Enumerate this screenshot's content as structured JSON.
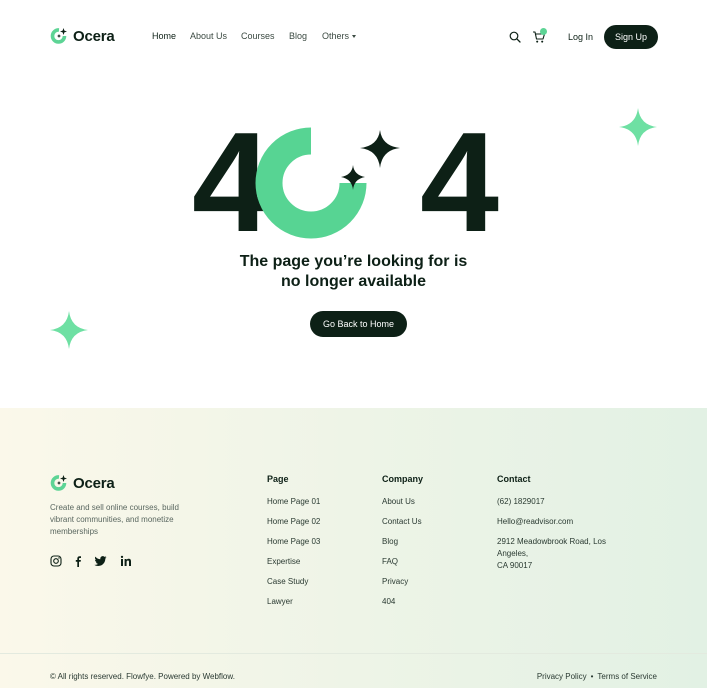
{
  "brand": {
    "name": "Ocera",
    "accent": "#5dd495",
    "dark": "#0d2016"
  },
  "nav": {
    "items": [
      "Home",
      "About Us",
      "Courses",
      "Blog",
      "Others"
    ],
    "login": "Log In",
    "signup": "Sign Up"
  },
  "hero": {
    "code_digit_left": "4",
    "code_digit_right": "4",
    "headline_line1": "The page you’re looking for is",
    "headline_line2": "no longer available",
    "cta": "Go Back to Home"
  },
  "footer": {
    "brand_name": "Ocera",
    "description": "Create and sell online courses, build vibrant communities, and monetize memberships",
    "socials": [
      "instagram-icon",
      "facebook-icon",
      "twitter-icon",
      "linkedin-icon"
    ],
    "columns": [
      {
        "title": "Page",
        "links": [
          "Home Page 01",
          "Home Page 02",
          "Home Page 03",
          "Expertise",
          "Case Study",
          "Lawyer"
        ]
      },
      {
        "title": "Company",
        "links": [
          "About Us",
          "Contact Us",
          "Blog",
          "FAQ",
          "Privacy",
          "404"
        ]
      }
    ],
    "contact": {
      "title": "Contact",
      "phone": "(62) 1829017",
      "email": "Hello@readvisor.com",
      "address_line1": "2912 Meadowbrook Road, Los",
      "address_line2": "Angeles,",
      "address_line3": "CA 90017"
    },
    "copyright": "© All rights reserved. Flowfye.  Powered by Webflow.",
    "privacy": "Privacy Policy",
    "separator": "•",
    "terms": "Terms of Service"
  }
}
